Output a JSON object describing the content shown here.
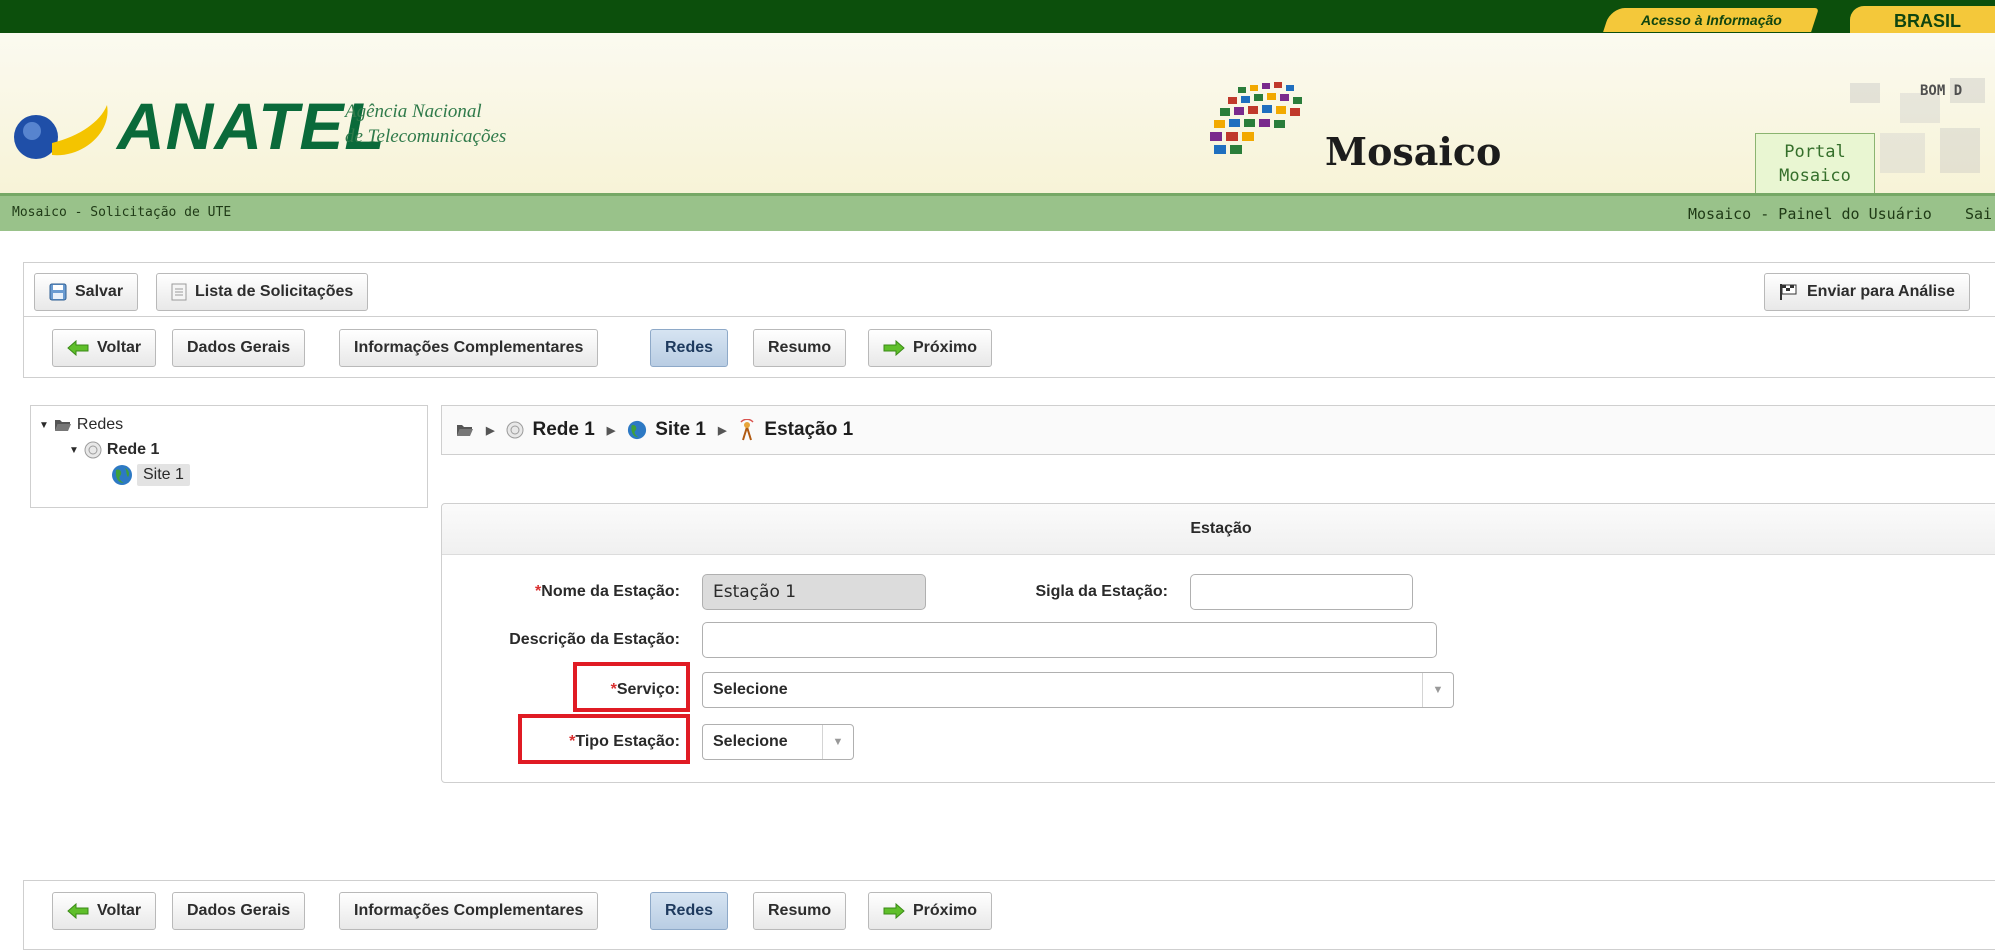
{
  "gov_bar": {
    "access_info": "Acesso à Informação",
    "brasil": "BRASIL"
  },
  "header": {
    "logo_text": "ANATEL",
    "logo_sub_line1": "Agência Nacional",
    "logo_sub_line2": "de Telecomunicações",
    "system_name": "Mosaico",
    "portal_tab_line1": "Portal",
    "portal_tab_line2": "Mosaico",
    "greeting": "BOM D"
  },
  "breadcrumb": {
    "left": "Mosaico - Solicitação de UTE",
    "user_panel": "Mosaico - Painel do Usuário",
    "exit": "Sai"
  },
  "toolbar": {
    "save": "Salvar",
    "requests_list": "Lista de Solicitações",
    "send_analysis": "Enviar para Análise"
  },
  "wizard": {
    "back": "Voltar",
    "general_data": "Dados Gerais",
    "complementary_info": "Informações Complementares",
    "networks": "Redes",
    "summary": "Resumo",
    "next": "Próximo"
  },
  "tree": {
    "root": "Redes",
    "network": "Rede 1",
    "site": "Site 1"
  },
  "path": {
    "network": "Rede 1",
    "site": "Site 1",
    "station": "Estação 1"
  },
  "form": {
    "title": "Estação",
    "required_mark": "*",
    "station_name_label": "Nome da Estação:",
    "station_name_value": "Estação 1",
    "station_code_label": "Sigla da Estação:",
    "station_code_value": "",
    "description_label": "Descrição da Estação:",
    "description_value": "",
    "service_label": "Serviço:",
    "service_value": "Selecione",
    "station_type_label": "Tipo Estação:",
    "station_type_value": "Selecione"
  },
  "colors": {
    "gov_green": "#0c4f0c",
    "gov_yellow": "#f4c83a",
    "crumb_green": "#99c28a",
    "highlight_red": "#e01b24",
    "active_tab": "#c8d9ec"
  }
}
